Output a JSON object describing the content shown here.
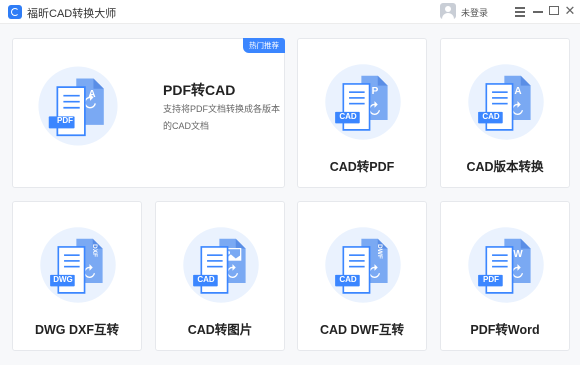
{
  "app": {
    "title": "福昕CAD转换大师",
    "login_text": "未登录"
  },
  "featured": {
    "badge": "热门推荐",
    "title": "PDF转CAD",
    "description": "支持将PDF文档转换成各版本的CAD文档",
    "icon": {
      "front": "PDF",
      "back": "A"
    }
  },
  "cards": [
    {
      "label": "CAD转PDF",
      "front": "CAD",
      "back": "P"
    },
    {
      "label": "CAD版本转换",
      "front": "CAD",
      "back": "A"
    },
    {
      "label": "DWG DXF互转",
      "front": "DWG",
      "back": "DXF"
    },
    {
      "label": "CAD转图片",
      "front": "CAD",
      "back": "image"
    },
    {
      "label": "CAD DWF互转",
      "front": "CAD",
      "back": "DWF"
    },
    {
      "label": "PDF转Word",
      "front": "PDF",
      "back": "W"
    }
  ],
  "colors": {
    "accent": "#3b86ff",
    "icon_circle": "#eaf2fe",
    "doc_back": "#7aa9f3",
    "doc_front": "#ffffff"
  }
}
